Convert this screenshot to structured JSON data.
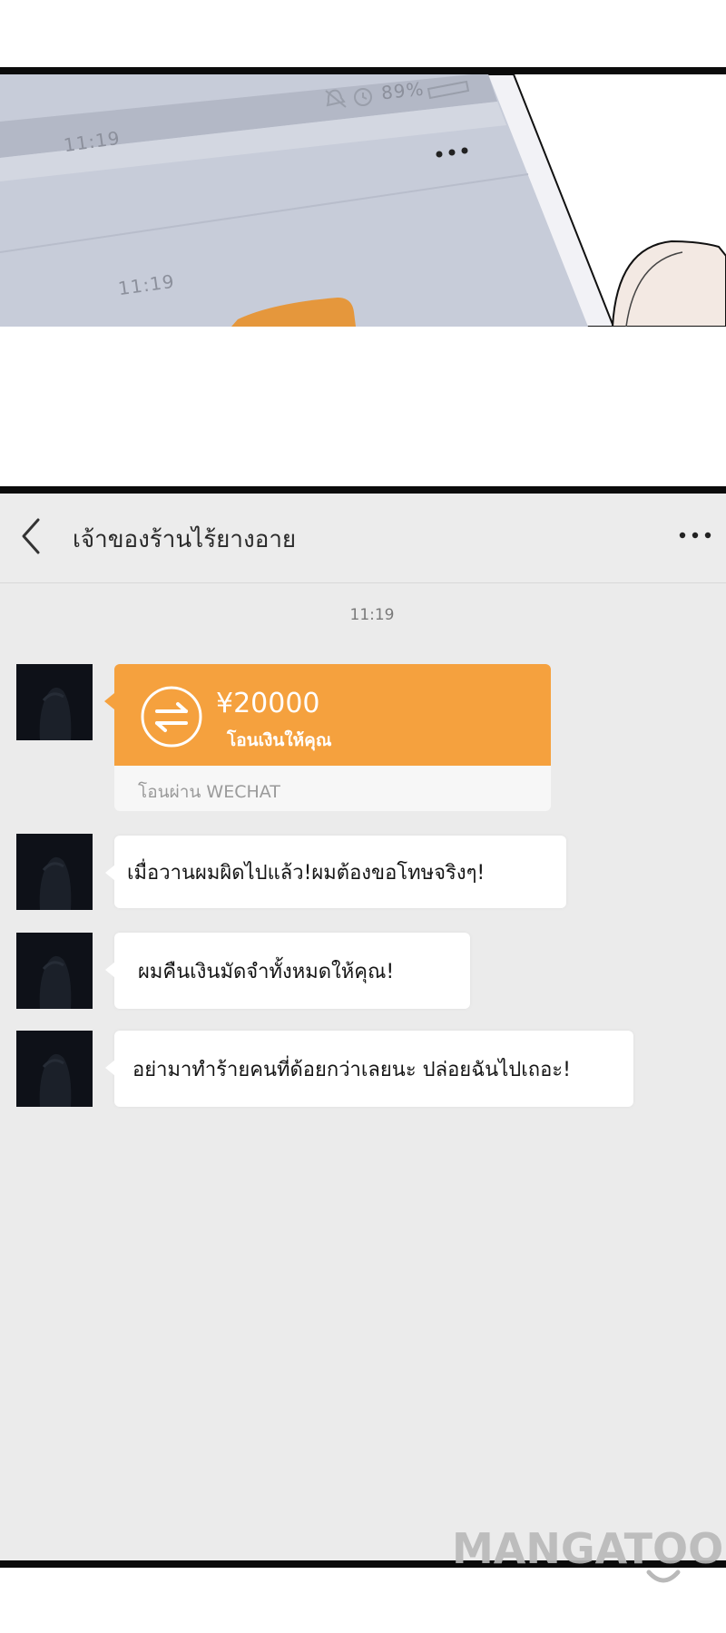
{
  "phone_panel": {
    "status_time": "11:19",
    "battery": "89%",
    "timestamp": "11:19"
  },
  "chat": {
    "title": "เจ้าของร้านไร้ยางอาย",
    "timestamp": "11:19",
    "transfer": {
      "amount": "¥20000",
      "note": "โอนเงินให้คุณ",
      "source": "โอนผ่าน WECHAT",
      "color": "#f5a13e"
    },
    "messages": [
      "เมื่อวานผมผิดไปแล้ว!ผมต้องขอโทษจริงๆ!",
      "ผมคืนเงินมัดจำทั้งหมดให้คุณ!",
      "อย่ามาทำร้ายคนที่ด้อยกว่าเลยนะ ปล่อยฉันไปเถอะ!"
    ]
  },
  "icons": {
    "back": "chevron-left-icon",
    "more": "more-dots-icon",
    "transfer": "transfer-arrows-icon",
    "mute": "mute-bell-icon",
    "alarm": "alarm-clock-icon",
    "battery": "battery-icon"
  },
  "watermark": "MANGATOON"
}
